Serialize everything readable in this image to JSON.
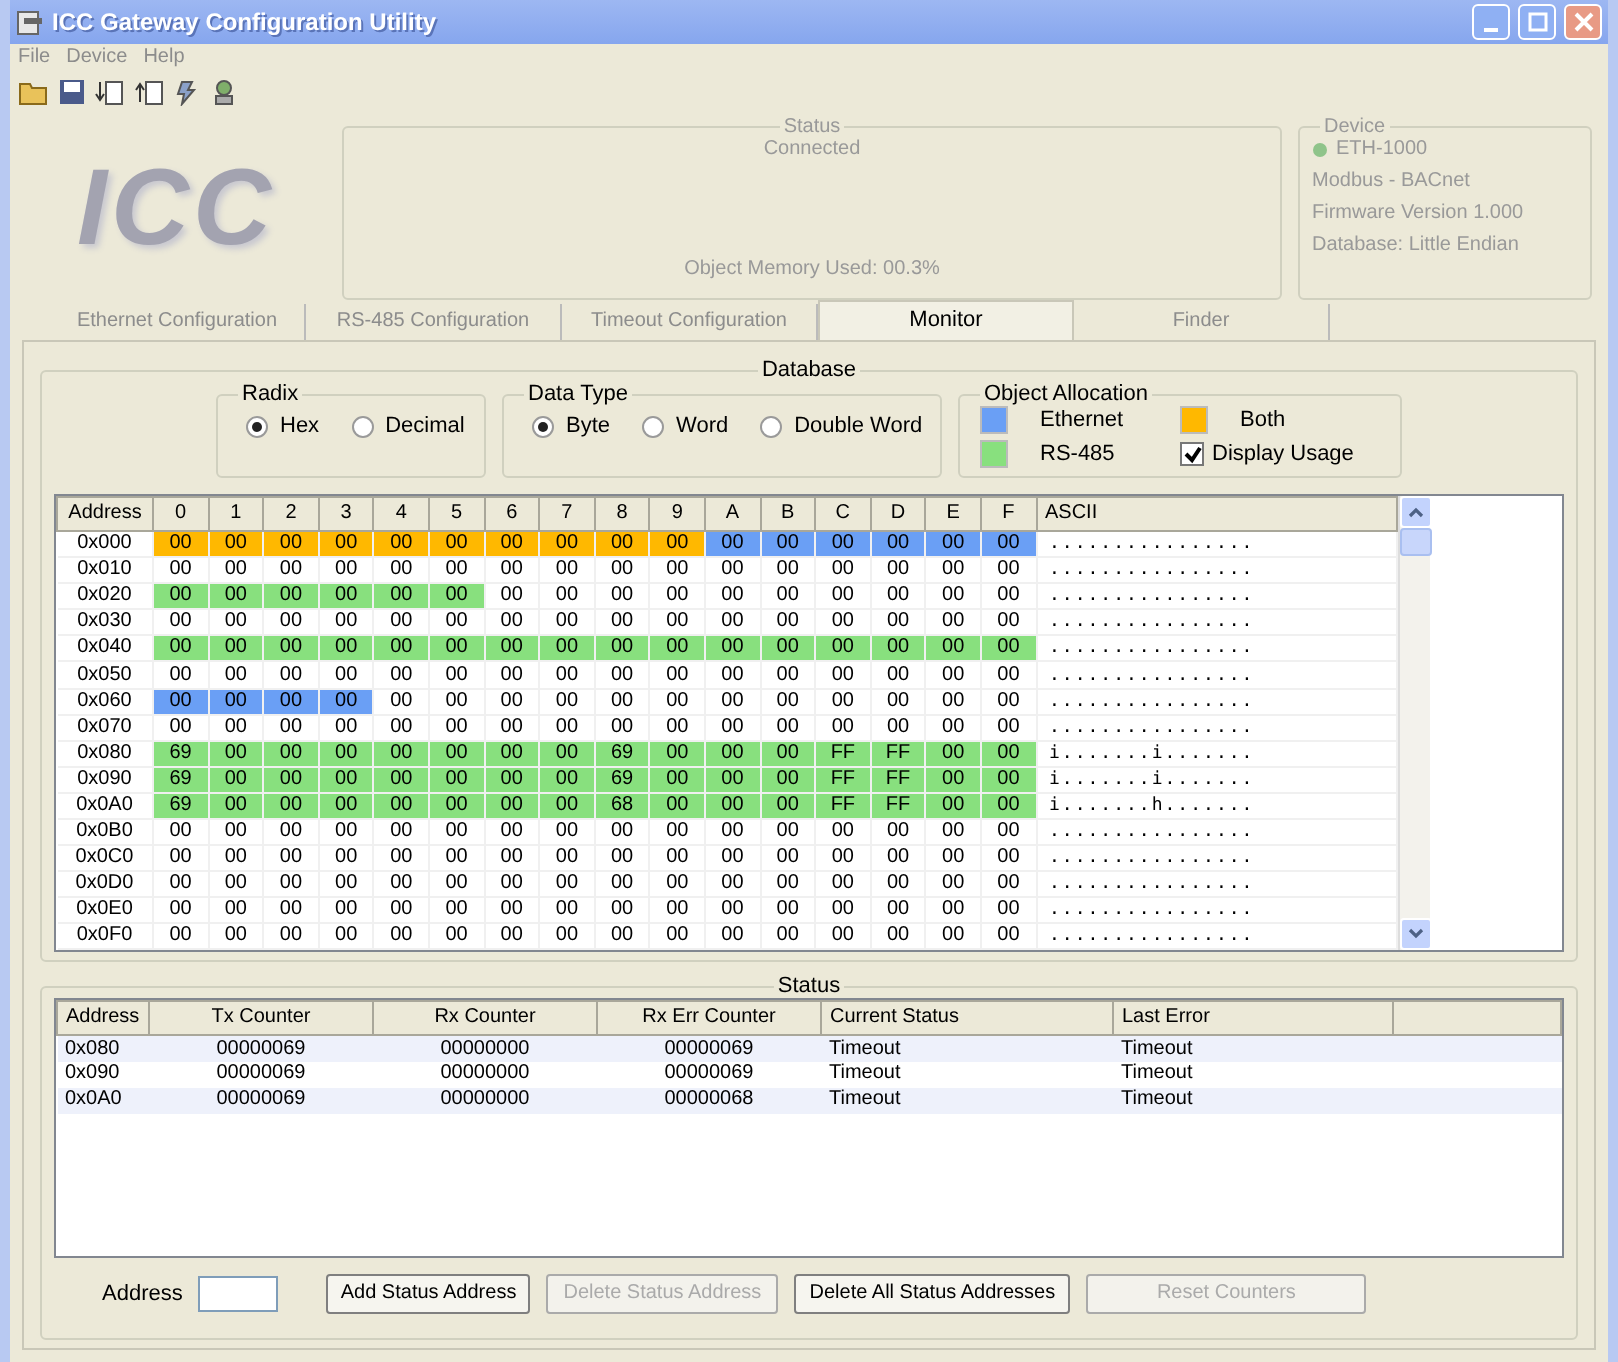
{
  "window": {
    "title": "ICC Gateway Configuration Utility"
  },
  "menu": [
    "File",
    "Device",
    "Help"
  ],
  "logo": "ICC",
  "status": {
    "title": "Status",
    "connection": "Connected",
    "memory": "Object Memory Used: 00.3%"
  },
  "device": {
    "title": "Device",
    "name": "ETH-1000",
    "protocol": "Modbus - BACnet",
    "firmware": "Firmware Version 1.000",
    "database": "Database: Little Endian"
  },
  "tabs": [
    {
      "label": "Ethernet Configuration",
      "selected": false
    },
    {
      "label": "RS-485 Configuration",
      "selected": false
    },
    {
      "label": "Timeout Configuration",
      "selected": false
    },
    {
      "label": "Monitor",
      "selected": true
    },
    {
      "label": "Finder",
      "selected": false
    }
  ],
  "database": {
    "title": "Database",
    "radix": {
      "title": "Radix",
      "options": [
        {
          "label": "Hex",
          "selected": true
        },
        {
          "label": "Decimal",
          "selected": false
        }
      ]
    },
    "data_type": {
      "title": "Data Type",
      "options": [
        {
          "label": "Byte",
          "selected": true
        },
        {
          "label": "Word",
          "selected": false
        },
        {
          "label": "Double Word",
          "selected": false
        }
      ]
    },
    "allocation": {
      "title": "Object Allocation",
      "legend": [
        {
          "label": "Ethernet",
          "color": "#6a9ff5"
        },
        {
          "label": "Both",
          "color": "#ffb800"
        },
        {
          "label": "RS-485",
          "color": "#88e07e"
        }
      ],
      "display_usage": {
        "label": "Display Usage",
        "checked": true
      }
    },
    "grid": {
      "columns": [
        "Address",
        "0",
        "1",
        "2",
        "3",
        "4",
        "5",
        "6",
        "7",
        "8",
        "9",
        "A",
        "B",
        "C",
        "D",
        "E",
        "F",
        "ASCII"
      ],
      "rows": [
        [
          {
            "text": "0x000"
          },
          {
            "text": "00",
            "color": "#ffb800"
          },
          {
            "text": "00",
            "color": "#ffb800"
          },
          {
            "text": "00",
            "color": "#ffb800"
          },
          {
            "text": "00",
            "color": "#ffb800"
          },
          {
            "text": "00",
            "color": "#ffb800"
          },
          {
            "text": "00",
            "color": "#ffb800"
          },
          {
            "text": "00",
            "color": "#ffb800"
          },
          {
            "text": "00",
            "color": "#ffb800"
          },
          {
            "text": "00",
            "color": "#ffb800"
          },
          {
            "text": "00",
            "color": "#ffb800"
          },
          {
            "text": "00",
            "color": "#6a9ff5"
          },
          {
            "text": "00",
            "color": "#6a9ff5"
          },
          {
            "text": "00",
            "color": "#6a9ff5"
          },
          {
            "text": "00",
            "color": "#6a9ff5"
          },
          {
            "text": "00",
            "color": "#6a9ff5"
          },
          {
            "text": "00",
            "color": "#6a9ff5"
          },
          {
            "text": "................"
          }
        ],
        [
          {
            "text": "0x010"
          },
          {
            "text": "00"
          },
          {
            "text": "00"
          },
          {
            "text": "00"
          },
          {
            "text": "00"
          },
          {
            "text": "00"
          },
          {
            "text": "00"
          },
          {
            "text": "00"
          },
          {
            "text": "00"
          },
          {
            "text": "00"
          },
          {
            "text": "00"
          },
          {
            "text": "00"
          },
          {
            "text": "00"
          },
          {
            "text": "00"
          },
          {
            "text": "00"
          },
          {
            "text": "00"
          },
          {
            "text": "00"
          },
          {
            "text": "................"
          }
        ],
        [
          {
            "text": "0x020"
          },
          {
            "text": "00",
            "color": "#88e07e"
          },
          {
            "text": "00",
            "color": "#88e07e"
          },
          {
            "text": "00",
            "color": "#88e07e"
          },
          {
            "text": "00",
            "color": "#88e07e"
          },
          {
            "text": "00",
            "color": "#88e07e"
          },
          {
            "text": "00",
            "color": "#88e07e"
          },
          {
            "text": "00"
          },
          {
            "text": "00"
          },
          {
            "text": "00"
          },
          {
            "text": "00"
          },
          {
            "text": "00"
          },
          {
            "text": "00"
          },
          {
            "text": "00"
          },
          {
            "text": "00"
          },
          {
            "text": "00"
          },
          {
            "text": "00"
          },
          {
            "text": "................"
          }
        ],
        [
          {
            "text": "0x030"
          },
          {
            "text": "00"
          },
          {
            "text": "00"
          },
          {
            "text": "00"
          },
          {
            "text": "00"
          },
          {
            "text": "00"
          },
          {
            "text": "00"
          },
          {
            "text": "00"
          },
          {
            "text": "00"
          },
          {
            "text": "00"
          },
          {
            "text": "00"
          },
          {
            "text": "00"
          },
          {
            "text": "00"
          },
          {
            "text": "00"
          },
          {
            "text": "00"
          },
          {
            "text": "00"
          },
          {
            "text": "00"
          },
          {
            "text": "................"
          }
        ],
        [
          {
            "text": "0x040"
          },
          {
            "text": "00",
            "color": "#88e07e"
          },
          {
            "text": "00",
            "color": "#88e07e"
          },
          {
            "text": "00",
            "color": "#88e07e"
          },
          {
            "text": "00",
            "color": "#88e07e"
          },
          {
            "text": "00",
            "color": "#88e07e"
          },
          {
            "text": "00",
            "color": "#88e07e"
          },
          {
            "text": "00",
            "color": "#88e07e"
          },
          {
            "text": "00",
            "color": "#88e07e"
          },
          {
            "text": "00",
            "color": "#88e07e"
          },
          {
            "text": "00",
            "color": "#88e07e"
          },
          {
            "text": "00",
            "color": "#88e07e"
          },
          {
            "text": "00",
            "color": "#88e07e"
          },
          {
            "text": "00",
            "color": "#88e07e"
          },
          {
            "text": "00",
            "color": "#88e07e"
          },
          {
            "text": "00",
            "color": "#88e07e"
          },
          {
            "text": "00",
            "color": "#88e07e"
          },
          {
            "text": "................"
          }
        ],
        [
          {
            "text": "0x050"
          },
          {
            "text": "00"
          },
          {
            "text": "00"
          },
          {
            "text": "00"
          },
          {
            "text": "00"
          },
          {
            "text": "00"
          },
          {
            "text": "00"
          },
          {
            "text": "00"
          },
          {
            "text": "00"
          },
          {
            "text": "00"
          },
          {
            "text": "00"
          },
          {
            "text": "00"
          },
          {
            "text": "00"
          },
          {
            "text": "00"
          },
          {
            "text": "00"
          },
          {
            "text": "00"
          },
          {
            "text": "00"
          },
          {
            "text": "................"
          }
        ],
        [
          {
            "text": "0x060"
          },
          {
            "text": "00",
            "color": "#6a9ff5"
          },
          {
            "text": "00",
            "color": "#6a9ff5"
          },
          {
            "text": "00",
            "color": "#6a9ff5"
          },
          {
            "text": "00",
            "color": "#6a9ff5"
          },
          {
            "text": "00"
          },
          {
            "text": "00"
          },
          {
            "text": "00"
          },
          {
            "text": "00"
          },
          {
            "text": "00"
          },
          {
            "text": "00"
          },
          {
            "text": "00"
          },
          {
            "text": "00"
          },
          {
            "text": "00"
          },
          {
            "text": "00"
          },
          {
            "text": "00"
          },
          {
            "text": "00"
          },
          {
            "text": "................"
          }
        ],
        [
          {
            "text": "0x070"
          },
          {
            "text": "00"
          },
          {
            "text": "00"
          },
          {
            "text": "00"
          },
          {
            "text": "00"
          },
          {
            "text": "00"
          },
          {
            "text": "00"
          },
          {
            "text": "00"
          },
          {
            "text": "00"
          },
          {
            "text": "00"
          },
          {
            "text": "00"
          },
          {
            "text": "00"
          },
          {
            "text": "00"
          },
          {
            "text": "00"
          },
          {
            "text": "00"
          },
          {
            "text": "00"
          },
          {
            "text": "00"
          },
          {
            "text": "................"
          }
        ],
        [
          {
            "text": "0x080"
          },
          {
            "text": "69",
            "color": "#88e07e"
          },
          {
            "text": "00",
            "color": "#88e07e"
          },
          {
            "text": "00",
            "color": "#88e07e"
          },
          {
            "text": "00",
            "color": "#88e07e"
          },
          {
            "text": "00",
            "color": "#88e07e"
          },
          {
            "text": "00",
            "color": "#88e07e"
          },
          {
            "text": "00",
            "color": "#88e07e"
          },
          {
            "text": "00",
            "color": "#88e07e"
          },
          {
            "text": "69",
            "color": "#88e07e"
          },
          {
            "text": "00",
            "color": "#88e07e"
          },
          {
            "text": "00",
            "color": "#88e07e"
          },
          {
            "text": "00",
            "color": "#88e07e"
          },
          {
            "text": "FF",
            "color": "#88e07e"
          },
          {
            "text": "FF",
            "color": "#88e07e"
          },
          {
            "text": "00",
            "color": "#88e07e"
          },
          {
            "text": "00",
            "color": "#88e07e"
          },
          {
            "text": "i.......i......."
          }
        ],
        [
          {
            "text": "0x090"
          },
          {
            "text": "69",
            "color": "#88e07e"
          },
          {
            "text": "00",
            "color": "#88e07e"
          },
          {
            "text": "00",
            "color": "#88e07e"
          },
          {
            "text": "00",
            "color": "#88e07e"
          },
          {
            "text": "00",
            "color": "#88e07e"
          },
          {
            "text": "00",
            "color": "#88e07e"
          },
          {
            "text": "00",
            "color": "#88e07e"
          },
          {
            "text": "00",
            "color": "#88e07e"
          },
          {
            "text": "69",
            "color": "#88e07e"
          },
          {
            "text": "00",
            "color": "#88e07e"
          },
          {
            "text": "00",
            "color": "#88e07e"
          },
          {
            "text": "00",
            "color": "#88e07e"
          },
          {
            "text": "FF",
            "color": "#88e07e"
          },
          {
            "text": "FF",
            "color": "#88e07e"
          },
          {
            "text": "00",
            "color": "#88e07e"
          },
          {
            "text": "00",
            "color": "#88e07e"
          },
          {
            "text": "i.......i......."
          }
        ],
        [
          {
            "text": "0x0A0"
          },
          {
            "text": "69",
            "color": "#88e07e"
          },
          {
            "text": "00",
            "color": "#88e07e"
          },
          {
            "text": "00",
            "color": "#88e07e"
          },
          {
            "text": "00",
            "color": "#88e07e"
          },
          {
            "text": "00",
            "color": "#88e07e"
          },
          {
            "text": "00",
            "color": "#88e07e"
          },
          {
            "text": "00",
            "color": "#88e07e"
          },
          {
            "text": "00",
            "color": "#88e07e"
          },
          {
            "text": "68",
            "color": "#88e07e"
          },
          {
            "text": "00",
            "color": "#88e07e"
          },
          {
            "text": "00",
            "color": "#88e07e"
          },
          {
            "text": "00",
            "color": "#88e07e"
          },
          {
            "text": "FF",
            "color": "#88e07e"
          },
          {
            "text": "FF",
            "color": "#88e07e"
          },
          {
            "text": "00",
            "color": "#88e07e"
          },
          {
            "text": "00",
            "color": "#88e07e"
          },
          {
            "text": "i.......h......."
          }
        ],
        [
          {
            "text": "0x0B0"
          },
          {
            "text": "00"
          },
          {
            "text": "00"
          },
          {
            "text": "00"
          },
          {
            "text": "00"
          },
          {
            "text": "00"
          },
          {
            "text": "00"
          },
          {
            "text": "00"
          },
          {
            "text": "00"
          },
          {
            "text": "00"
          },
          {
            "text": "00"
          },
          {
            "text": "00"
          },
          {
            "text": "00"
          },
          {
            "text": "00"
          },
          {
            "text": "00"
          },
          {
            "text": "00"
          },
          {
            "text": "00"
          },
          {
            "text": "................"
          }
        ],
        [
          {
            "text": "0x0C0"
          },
          {
            "text": "00"
          },
          {
            "text": "00"
          },
          {
            "text": "00"
          },
          {
            "text": "00"
          },
          {
            "text": "00"
          },
          {
            "text": "00"
          },
          {
            "text": "00"
          },
          {
            "text": "00"
          },
          {
            "text": "00"
          },
          {
            "text": "00"
          },
          {
            "text": "00"
          },
          {
            "text": "00"
          },
          {
            "text": "00"
          },
          {
            "text": "00"
          },
          {
            "text": "00"
          },
          {
            "text": "00"
          },
          {
            "text": "................"
          }
        ],
        [
          {
            "text": "0x0D0"
          },
          {
            "text": "00"
          },
          {
            "text": "00"
          },
          {
            "text": "00"
          },
          {
            "text": "00"
          },
          {
            "text": "00"
          },
          {
            "text": "00"
          },
          {
            "text": "00"
          },
          {
            "text": "00"
          },
          {
            "text": "00"
          },
          {
            "text": "00"
          },
          {
            "text": "00"
          },
          {
            "text": "00"
          },
          {
            "text": "00"
          },
          {
            "text": "00"
          },
          {
            "text": "00"
          },
          {
            "text": "00"
          },
          {
            "text": "................"
          }
        ],
        [
          {
            "text": "0x0E0"
          },
          {
            "text": "00"
          },
          {
            "text": "00"
          },
          {
            "text": "00"
          },
          {
            "text": "00"
          },
          {
            "text": "00"
          },
          {
            "text": "00"
          },
          {
            "text": "00"
          },
          {
            "text": "00"
          },
          {
            "text": "00"
          },
          {
            "text": "00"
          },
          {
            "text": "00"
          },
          {
            "text": "00"
          },
          {
            "text": "00"
          },
          {
            "text": "00"
          },
          {
            "text": "00"
          },
          {
            "text": "00"
          },
          {
            "text": "................"
          }
        ],
        [
          {
            "text": "0x0F0"
          },
          {
            "text": "00"
          },
          {
            "text": "00"
          },
          {
            "text": "00"
          },
          {
            "text": "00"
          },
          {
            "text": "00"
          },
          {
            "text": "00"
          },
          {
            "text": "00"
          },
          {
            "text": "00"
          },
          {
            "text": "00"
          },
          {
            "text": "00"
          },
          {
            "text": "00"
          },
          {
            "text": "00"
          },
          {
            "text": "00"
          },
          {
            "text": "00"
          },
          {
            "text": "00"
          },
          {
            "text": "00"
          },
          {
            "text": "................"
          }
        ]
      ]
    }
  },
  "status_list": {
    "title": "Status",
    "columns": [
      "Address",
      "Tx Counter",
      "Rx Counter",
      "Rx Err Counter",
      "Current Status",
      "Last Error"
    ],
    "rows": [
      {
        "address": "0x080",
        "tx": "00000069",
        "rx": "00000000",
        "rx_err": "00000069",
        "current": "Timeout",
        "last_error": "Timeout"
      },
      {
        "address": "0x090",
        "tx": "00000069",
        "rx": "00000000",
        "rx_err": "00000069",
        "current": "Timeout",
        "last_error": "Timeout"
      },
      {
        "address": "0x0A0",
        "tx": "00000069",
        "rx": "00000000",
        "rx_err": "00000068",
        "current": "Timeout",
        "last_error": "Timeout"
      }
    ]
  },
  "controls": {
    "address_label": "Address",
    "buttons": [
      {
        "label": "Add Status Address",
        "disabled": false
      },
      {
        "label": "Delete Status Address",
        "disabled": true
      },
      {
        "label": "Delete All Status Addresses",
        "disabled": false
      },
      {
        "label": "Reset Counters",
        "disabled": true
      }
    ]
  }
}
